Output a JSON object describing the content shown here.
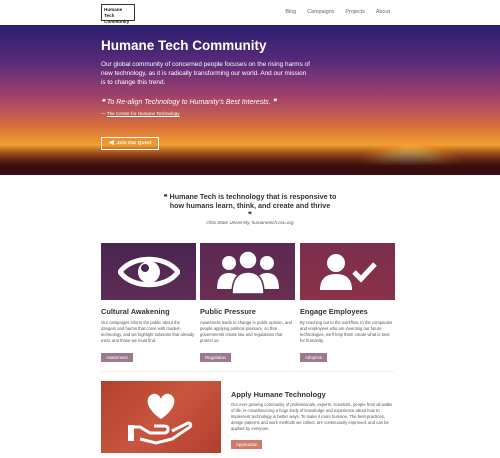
{
  "nav": {
    "logo_line1": "Humane Tech",
    "logo_line2": "Community",
    "links": [
      "Blog",
      "Campaigns",
      "Projects",
      "About"
    ]
  },
  "hero": {
    "title": "Humane Tech Community",
    "intro": "Our global community of concerned people focuses on the rising harms of new technology, as it is radically transforming our world. And our mission is to change this trend.",
    "quote": "To Re-align Technology to Humanity's Best Interests.",
    "source_dash": "— ",
    "source_link": "The Center for Humane Technology",
    "join_label": "Join Our Quest"
  },
  "main_quote": {
    "text": "Humane Tech is technology that is responsive to how humans learn, think, and create and thrive",
    "attribution": "Ohio State University, humanetech.osu.org"
  },
  "cards": [
    {
      "title": "Cultural Awakening",
      "text": "Our campaigns inform the public about the dangers and harms that come with modern technology, and we highlight solutions that already exist, and those we must find.",
      "button": "Awareness",
      "color_top": "#4a2452",
      "color_bottom": "#5e2d55"
    },
    {
      "title": "Public Pressure",
      "text": "Awareness leads to change in public opinion, and people applying political pressure, so that governments create law and regulations that protect us.",
      "button": "Regulation",
      "color_top": "#5a2a55",
      "color_bottom": "#6a2e52"
    },
    {
      "title": "Engage Employees",
      "text": "By reaching out to the workflow, to the companies and employees who are inventing our future technologies, we'll help them create what is best for humanity.",
      "button": "Adoption",
      "color_top": "#7a2e4e",
      "color_bottom": "#8a3248"
    }
  ],
  "apply": {
    "title": "Apply Humane Technology",
    "text": "Our ever growing community of professionals, experts, scientists, people from all walks of life, is crowdsourcing a huge body of knowledge and experience about how to implement technology in better ways. To make it more humane. The best-practices, design patterns and work methods we collect, are continuously improved, and can be applied by everyone.",
    "button": "Application"
  }
}
